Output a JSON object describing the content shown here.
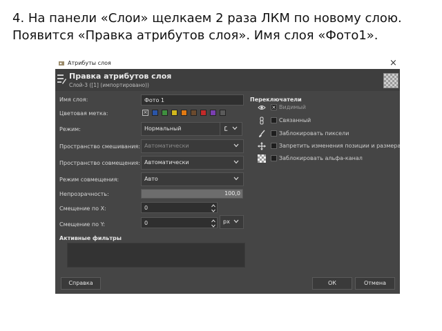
{
  "instruction_text": "4. На панели «Слои» щелкаем 2 раза ЛКМ по новому слою. Появится «Правка атрибутов слоя». Имя слоя «Фото1».",
  "window": {
    "title": "Атрибуты слоя",
    "close_label": "×"
  },
  "header": {
    "title": "Правка атрибутов слоя",
    "subtitle": "Слой-3 ([1] (импортировано))"
  },
  "form": {
    "name_label": "Имя слоя:",
    "name_value": "Фото 1",
    "color_tag_label": "Цветовая метка:",
    "color_tags": [
      "#2a55a8",
      "#3f8f3f",
      "#d2b81e",
      "#e07a14",
      "#6b4a2e",
      "#c22a2a",
      "#7a3fb0",
      "#5a5a5a"
    ],
    "mode_label": "Режим:",
    "mode_value": "Нормальный",
    "blend_space_label": "Пространство смешивания:",
    "blend_space_value": "Автоматически",
    "composite_space_label": "Пространство совмещения:",
    "composite_space_value": "Автоматически",
    "composite_mode_label": "Режим совмещения:",
    "composite_mode_value": "Авто",
    "opacity_label": "Непрозрачность:",
    "opacity_value": "100,0",
    "opacity_fraction": 1.0,
    "offset_x_label": "Смещение по X:",
    "offset_x_value": "0",
    "offset_y_label": "Смещение по Y:",
    "offset_y_value": "0",
    "unit_value": "px"
  },
  "filters": {
    "title": "Активные фильтры"
  },
  "switches": {
    "title": "Переключатели",
    "items": [
      {
        "label": "Видимый",
        "icon": "eye-icon",
        "checked": true
      },
      {
        "label": "Связанный",
        "icon": "chain-icon",
        "checked": false
      },
      {
        "label": "Заблокировать пиксели",
        "icon": "brush-icon",
        "checked": false
      },
      {
        "label": "Запретить изменения позиции и размера",
        "icon": "move-icon",
        "checked": false
      },
      {
        "label": "Заблокировать альфа-канал",
        "icon": "checker-icon",
        "checked": false
      }
    ]
  },
  "buttons": {
    "help": "Справка",
    "ok": "ОК",
    "cancel": "Отмена"
  }
}
